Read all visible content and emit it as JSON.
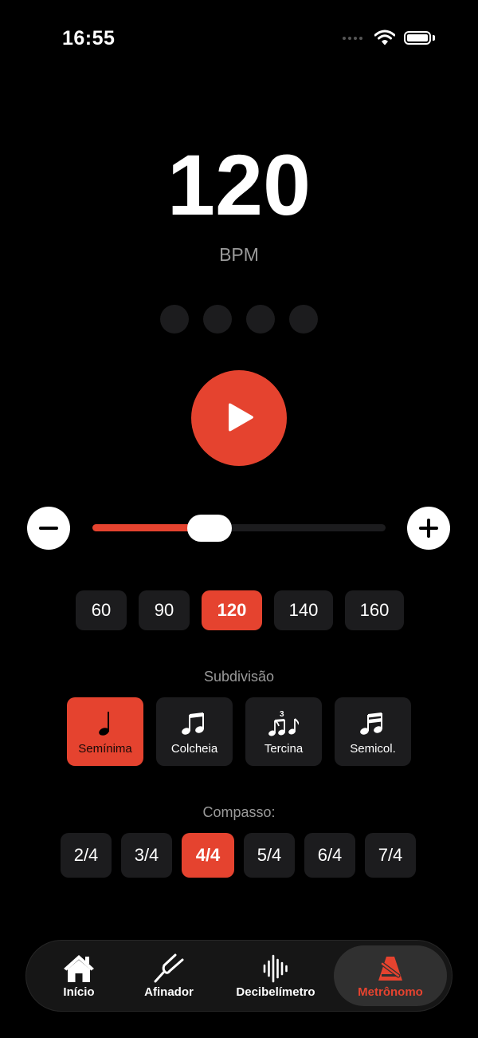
{
  "status_bar": {
    "time": "16:55"
  },
  "metronome": {
    "bpm": "120",
    "bpm_unit": "BPM",
    "beats_per_measure": 4,
    "tempo_slider": {
      "value": 120,
      "fraction": 0.4
    },
    "presets": [
      {
        "label": "60",
        "active": false
      },
      {
        "label": "90",
        "active": false
      },
      {
        "label": "120",
        "active": true
      },
      {
        "label": "140",
        "active": false
      },
      {
        "label": "160",
        "active": false
      }
    ],
    "subdivision_label": "Subdivisão",
    "subdivisions": [
      {
        "label": "Semínima",
        "icon": "quarter-note-icon",
        "active": true
      },
      {
        "label": "Colcheia",
        "icon": "eighth-notes-icon",
        "active": false
      },
      {
        "label": "Tercina",
        "icon": "triplet-icon",
        "active": false
      },
      {
        "label": "Semicol.",
        "icon": "sixteenth-notes-icon",
        "active": false
      }
    ],
    "time_signature_label": "Compasso:",
    "time_signatures": [
      {
        "label": "2/4",
        "active": false
      },
      {
        "label": "3/4",
        "active": false
      },
      {
        "label": "4/4",
        "active": true
      },
      {
        "label": "5/4",
        "active": false
      },
      {
        "label": "6/4",
        "active": false
      },
      {
        "label": "7/4",
        "active": false
      }
    ]
  },
  "tab_bar": {
    "tabs": [
      {
        "label": "Início",
        "icon": "home-icon",
        "active": false
      },
      {
        "label": "Afinador",
        "icon": "tuning-fork-icon",
        "active": false
      },
      {
        "label": "Decibelímetro",
        "icon": "waveform-icon",
        "active": false
      },
      {
        "label": "Metrônomo",
        "icon": "metronome-icon",
        "active": true
      }
    ]
  },
  "colors": {
    "accent": "#e5432f",
    "background": "#000000",
    "surface": "#1c1c1e",
    "muted_text": "#9a9a9a"
  }
}
